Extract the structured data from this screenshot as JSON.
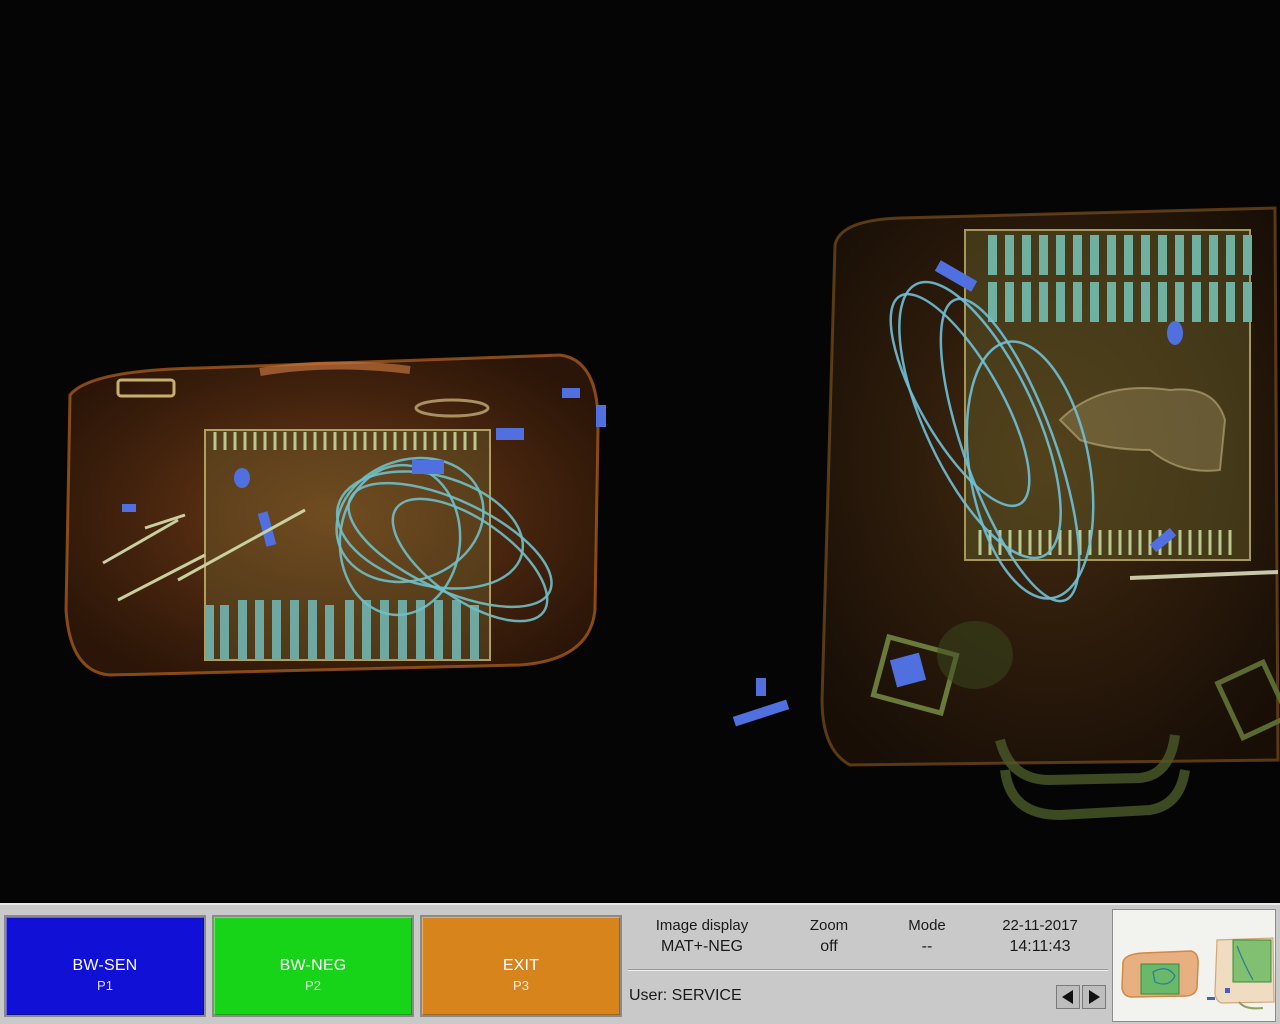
{
  "scan": {
    "background_color": "#050505",
    "bag_colors": {
      "organic": "#8a4a1c",
      "mixed": "#5f8a4a",
      "metal": "#4f6fd8",
      "wire": "#6fb8c8"
    }
  },
  "buttons": [
    {
      "label": "BW-SEN",
      "key": "P1",
      "color": "#1010d6"
    },
    {
      "label": "BW-NEG",
      "key": "P2",
      "color": "#18d418"
    },
    {
      "label": "EXIT",
      "key": "P3",
      "color": "#d8841c"
    }
  ],
  "status": {
    "image_display": {
      "label": "Image display",
      "value": "MAT+-NEG"
    },
    "zoom": {
      "label": "Zoom",
      "value": "off"
    },
    "mode": {
      "label": "Mode",
      "value": "--"
    },
    "date": "22-11-2017",
    "time": "14:11:43",
    "user": "User: SERVICE"
  },
  "navigation": {
    "prev_icon": "triangle-left-icon",
    "next_icon": "triangle-right-icon"
  }
}
